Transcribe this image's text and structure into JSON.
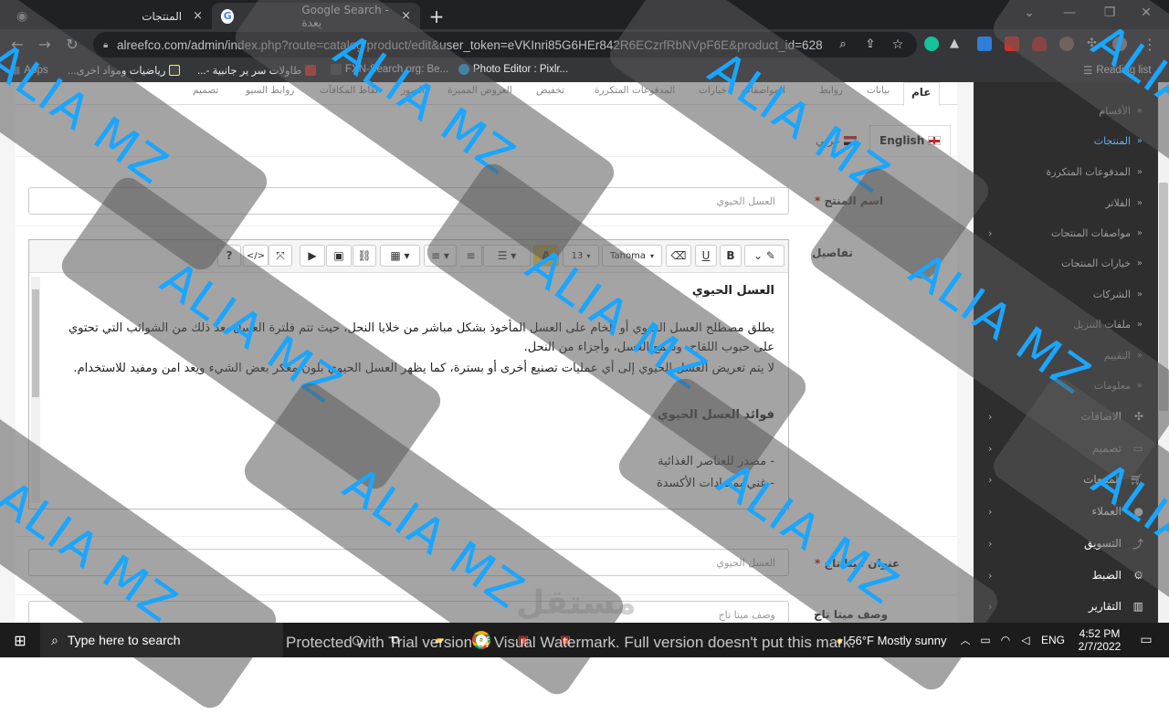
{
  "browser": {
    "tabs": [
      {
        "title": "المنتجات",
        "close": "×"
      },
      {
        "title": "Google Search - يعدة",
        "close": "×"
      }
    ],
    "new_tab": "+",
    "url": "alreefco.com/admin/index.php?route=catalog/product/edit&user_token=eVKInri85G6HEr842R6ECzrfRbNVpF6E&product_id=628",
    "bookmarks": [
      "Apps",
      "رياضيات ومواد اخرى...",
      "طاولات سر ير جانبية -...",
      "FXN-Search.org: Be...",
      "Photo Editor : Pixlr...",
      "Reading list"
    ]
  },
  "product_tabs": [
    "عام",
    "بيانات",
    "روابط",
    "المواصفات",
    "خيارات",
    "المدفوعات المتكررة",
    "تخفيض",
    "العروض المميزة",
    "الصور",
    "نقاط المكافآت",
    "روابط السيو",
    "تصميم"
  ],
  "languages": {
    "en": "English",
    "ar": "عربي"
  },
  "form": {
    "product_name_label": "اسم المنتج",
    "product_name_value": "العسل الحيوي",
    "details_label": "تفاصيل",
    "meta_title_label": "عنوان ميتا تاج",
    "meta_title_value": "العسل الحيوي",
    "meta_desc_label": "وصف ميتا تاج",
    "meta_desc_placeholder": "وصف ميتا تاج"
  },
  "editor": {
    "font_name": "Tahoma",
    "font_size": "13",
    "toolbar_icons": [
      "magic-wand-icon",
      "bold-icon",
      "underline-icon",
      "eraser-icon",
      "font-name-select",
      "font-size-select",
      "highlight-icon",
      "list-ul-icon",
      "list-ol-icon",
      "align-icon",
      "table-icon",
      "link-icon",
      "image-icon",
      "video-icon",
      "fullscreen-icon",
      "code-view-icon",
      "help-icon"
    ],
    "labels": {
      "bold": "B",
      "underline": "U",
      "highlight": "A",
      "code": "</>",
      "help": "?"
    },
    "content": {
      "title": "العسل الحيوي",
      "p1": "يطلق مصطلح العسل الحيوي أو الخام على العسل المأخوذ بشكل مباشر من خلايا النحل، حيث تتم فلترة العسل بعد ذلك من الشوائب التي تحتوي على حبوب اللقاح، وشمع العسل، وأجزاء من النحل.",
      "p2": "لا يتم تعريض العسل الحيوي إلى أي عمليات تصنيع أخرى أو بسترة، كما يظهر العسل الحيوي بلون معكر بعض الشيء ويعد امن ومفيد للاستخدام.",
      "h2": "فوائد العسل الحيوي",
      "li1": "- مصدر للعناصر الغذائية",
      "li2": "- غني بمضادات الأكسدة"
    }
  },
  "sidebar": {
    "sub_items": [
      "الأقسام",
      "المنتجات",
      "المدفوعات المتكررة",
      "الفلاتر",
      "مواصفات المنتجات",
      "خيارات المنتجات",
      "الشركات",
      "ملفات التنزيل",
      "التقييم",
      "معلومات"
    ],
    "main_items": [
      "الاضافات",
      "تصميم",
      "المبيعات",
      "العملاء",
      "التسويق",
      "الضبط",
      "التقارير"
    ]
  },
  "watermark": {
    "text": "ALIA MZ",
    "protected": "Protected with Trial version of Visual Watermark. Full version doesn't put this mark.",
    "brand": "مستقل"
  },
  "taskbar": {
    "search_placeholder": "Type here to search",
    "weather": "56°F Mostly sunny",
    "lang": "ENG",
    "time": "4:52 PM",
    "date": "2/7/2022"
  },
  "colors": {
    "sidebar_bg": "#2e2e2e",
    "accent_blue": "#1aa6ff",
    "chrome_dark": "#35363a"
  }
}
